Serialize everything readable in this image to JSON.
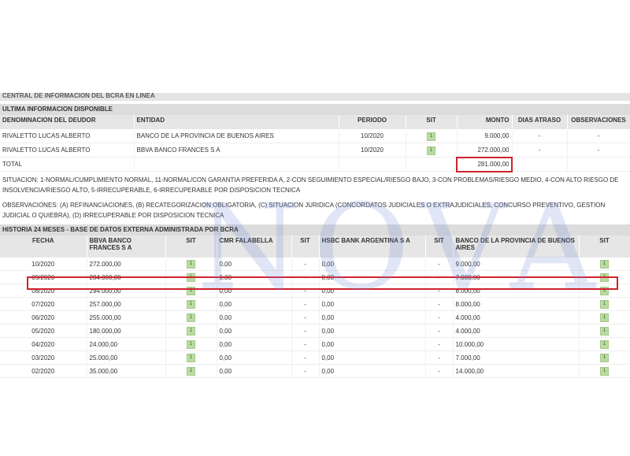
{
  "central_title": "CENTRAL DE INFORMACION DEL BCRA EN LINEA",
  "ultima": {
    "title": "ULTIMA INFORMACION DISPONIBLE",
    "headers": [
      "DENOMINACION DEL DEUDOR",
      "ENTIDAD",
      "PERIODO",
      "SIT",
      "MONTO",
      "DIAS ATRASO",
      "OBSERVACIONES"
    ],
    "rows": [
      {
        "deudor": "RIVALETTO LUCAS ALBERTO",
        "entidad": "BANCO DE LA PROVINCIA DE BUENOS AIRES",
        "periodo": "10/2020",
        "sit": "1",
        "monto": "9.000,00",
        "dias": "-",
        "obs": "-"
      },
      {
        "deudor": "RIVALETTO LUCAS ALBERTO",
        "entidad": "BBVA BANCO FRANCES S A",
        "periodo": "10/2020",
        "sit": "1",
        "monto": "272.000,00",
        "dias": "-",
        "obs": "-"
      }
    ],
    "total_label": "TOTAL",
    "total_value": "281.000,00"
  },
  "situacion_text": "SITUACION: 1-NORMAL/CUMPLIMIENTO NORMAL, 11-NORMAL/CON GARANTIA PREFERIDA A, 2-CON SEGUIMIENTO ESPECIAL/RIESGO BAJO, 3-CON PROBLEMAS/RIESGO MEDIO, 4-CON ALTO RIESGO DE INSOLVENCIA/RIESGO ALTO, 5-IRRECUPERABLE, 6-IRRECUPERABLE POR DISPOSICION TECNICA",
  "observaciones_text": "OBSERVACIONES: (A) REFINANCIACIONES, (B) RECATEGORIZACION OBLIGATORIA, (C) SITUACION JURIDICA (CONCORDATOS JUDICIALES O EXTRAJUDICIALES, CONCURSO PREVENTIVO, GESTION JUDICIAL O QUIEBRA), (D) IRRECUPERABLE POR DISPOSICION TECNICA",
  "historia": {
    "title": "HISTORIA 24 MESES - BASE DE DATOS EXTERNA ADMINISTRADA POR BCRA",
    "headers": [
      "FECHA",
      "BBVA BANCO FRANCES S A",
      "SIT",
      "CMR FALABELLA",
      "SIT",
      "HSBC BANK ARGENTINA S A",
      "SIT",
      "BANCO DE LA PROVINCIA DE BUENOS AIRES",
      "SIT"
    ],
    "rows": [
      {
        "fecha": "10/2020",
        "bbva": "272.000,00",
        "s1": "1",
        "cmr": "0,00",
        "s2": "-",
        "hsbc": "0,00",
        "s3": "-",
        "bpba": "9.000,00",
        "s4": "1"
      },
      {
        "fecha": "09/2020",
        "bbva": "284.000,00",
        "s1": "1",
        "cmr": "0,00",
        "s2": "-",
        "hsbc": "0,00",
        "s3": "-",
        "bpba": "7.000,00",
        "s4": "1"
      },
      {
        "fecha": "08/2020",
        "bbva": "294.000,00",
        "s1": "1",
        "cmr": "0,00",
        "s2": "-",
        "hsbc": "0,00",
        "s3": "-",
        "bpba": "8.000,00",
        "s4": "1"
      },
      {
        "fecha": "07/2020",
        "bbva": "257.000,00",
        "s1": "1",
        "cmr": "0,00",
        "s2": "-",
        "hsbc": "0,00",
        "s3": "-",
        "bpba": "8.000,00",
        "s4": "1"
      },
      {
        "fecha": "06/2020",
        "bbva": "255.000,00",
        "s1": "1",
        "cmr": "0,00",
        "s2": "-",
        "hsbc": "0,00",
        "s3": "-",
        "bpba": "4.000,00",
        "s4": "1"
      },
      {
        "fecha": "05/2020",
        "bbva": "180.000,00",
        "s1": "1",
        "cmr": "0,00",
        "s2": "-",
        "hsbc": "0,00",
        "s3": "-",
        "bpba": "4.000,00",
        "s4": "1"
      },
      {
        "fecha": "04/2020",
        "bbva": "24.000,00",
        "s1": "1",
        "cmr": "0,00",
        "s2": "-",
        "hsbc": "0,00",
        "s3": "-",
        "bpba": "10.000,00",
        "s4": "1"
      },
      {
        "fecha": "03/2020",
        "bbva": "25.000,00",
        "s1": "1",
        "cmr": "0,00",
        "s2": "-",
        "hsbc": "0,00",
        "s3": "-",
        "bpba": "7.000,00",
        "s4": "1"
      },
      {
        "fecha": "02/2020",
        "bbva": "35.000,00",
        "s1": "1",
        "cmr": "0,00",
        "s2": "-",
        "hsbc": "0,00",
        "s3": "-",
        "bpba": "14.000,00",
        "s4": "1"
      }
    ]
  },
  "watermark": "NOVA",
  "colors": {
    "highlight": "#d0222c",
    "sit_badge": "#b9dca0",
    "header_bg": "#dcdcdc"
  }
}
